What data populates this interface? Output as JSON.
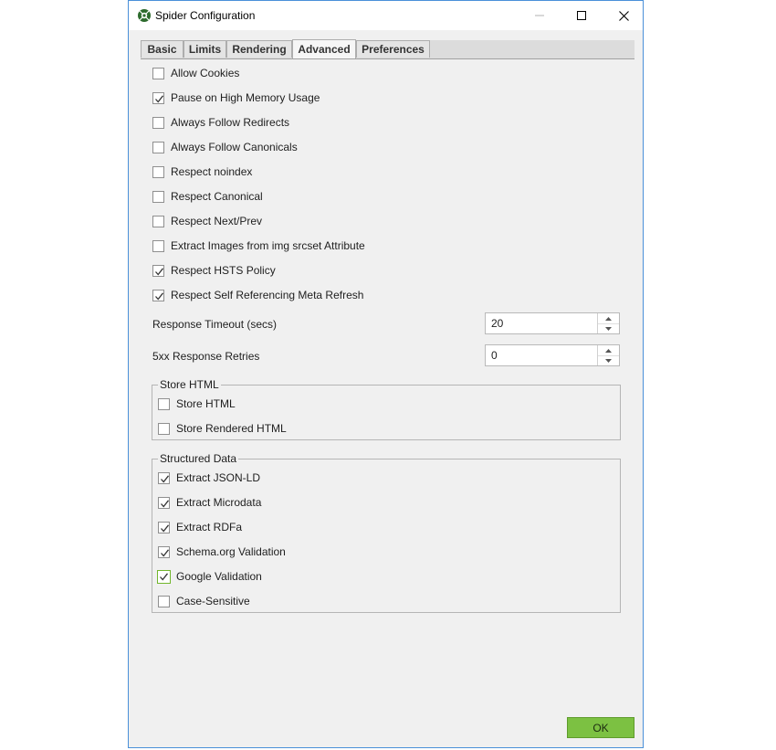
{
  "window": {
    "title": "Spider Configuration",
    "icon": "spider-logo-icon",
    "controls": [
      "minimize-icon",
      "maximize-icon",
      "close-icon"
    ]
  },
  "tabs": [
    {
      "label": "Basic",
      "active": false
    },
    {
      "label": "Limits",
      "active": false
    },
    {
      "label": "Rendering",
      "active": false
    },
    {
      "label": "Advanced",
      "active": true
    },
    {
      "label": "Preferences",
      "active": false
    }
  ],
  "options": [
    {
      "label": "Allow Cookies",
      "checked": false
    },
    {
      "label": "Pause on High Memory Usage",
      "checked": true
    },
    {
      "label": "Always Follow Redirects",
      "checked": false
    },
    {
      "label": "Always Follow Canonicals",
      "checked": false
    },
    {
      "label": "Respect noindex",
      "checked": false
    },
    {
      "label": "Respect Canonical",
      "checked": false
    },
    {
      "label": "Respect Next/Prev",
      "checked": false
    },
    {
      "label": "Extract Images from img srcset Attribute",
      "checked": false
    },
    {
      "label": "Respect HSTS Policy",
      "checked": true
    },
    {
      "label": "Respect Self Referencing Meta Refresh",
      "checked": true
    }
  ],
  "response_timeout": {
    "label": "Response Timeout (secs)",
    "value": "20"
  },
  "retries": {
    "label": "5xx Response Retries",
    "value": "0"
  },
  "store_html": {
    "title": "Store HTML",
    "items": [
      {
        "label": "Store HTML",
        "checked": false
      },
      {
        "label": "Store Rendered HTML",
        "checked": false
      }
    ]
  },
  "structured_data": {
    "title": "Structured Data",
    "items": [
      {
        "label": "Extract JSON-LD",
        "checked": true
      },
      {
        "label": "Extract Microdata",
        "checked": true
      },
      {
        "label": "Extract RDFa",
        "checked": true
      },
      {
        "label": "Schema.org Validation",
        "checked": true
      },
      {
        "label": "Google Validation",
        "checked": true,
        "focused": true
      },
      {
        "label": "Case-Sensitive",
        "checked": false
      }
    ]
  },
  "ok_label": "OK",
  "colors": {
    "accent": "#7cc142",
    "window_border": "#4a90d9",
    "background": "#f0f0f0"
  }
}
